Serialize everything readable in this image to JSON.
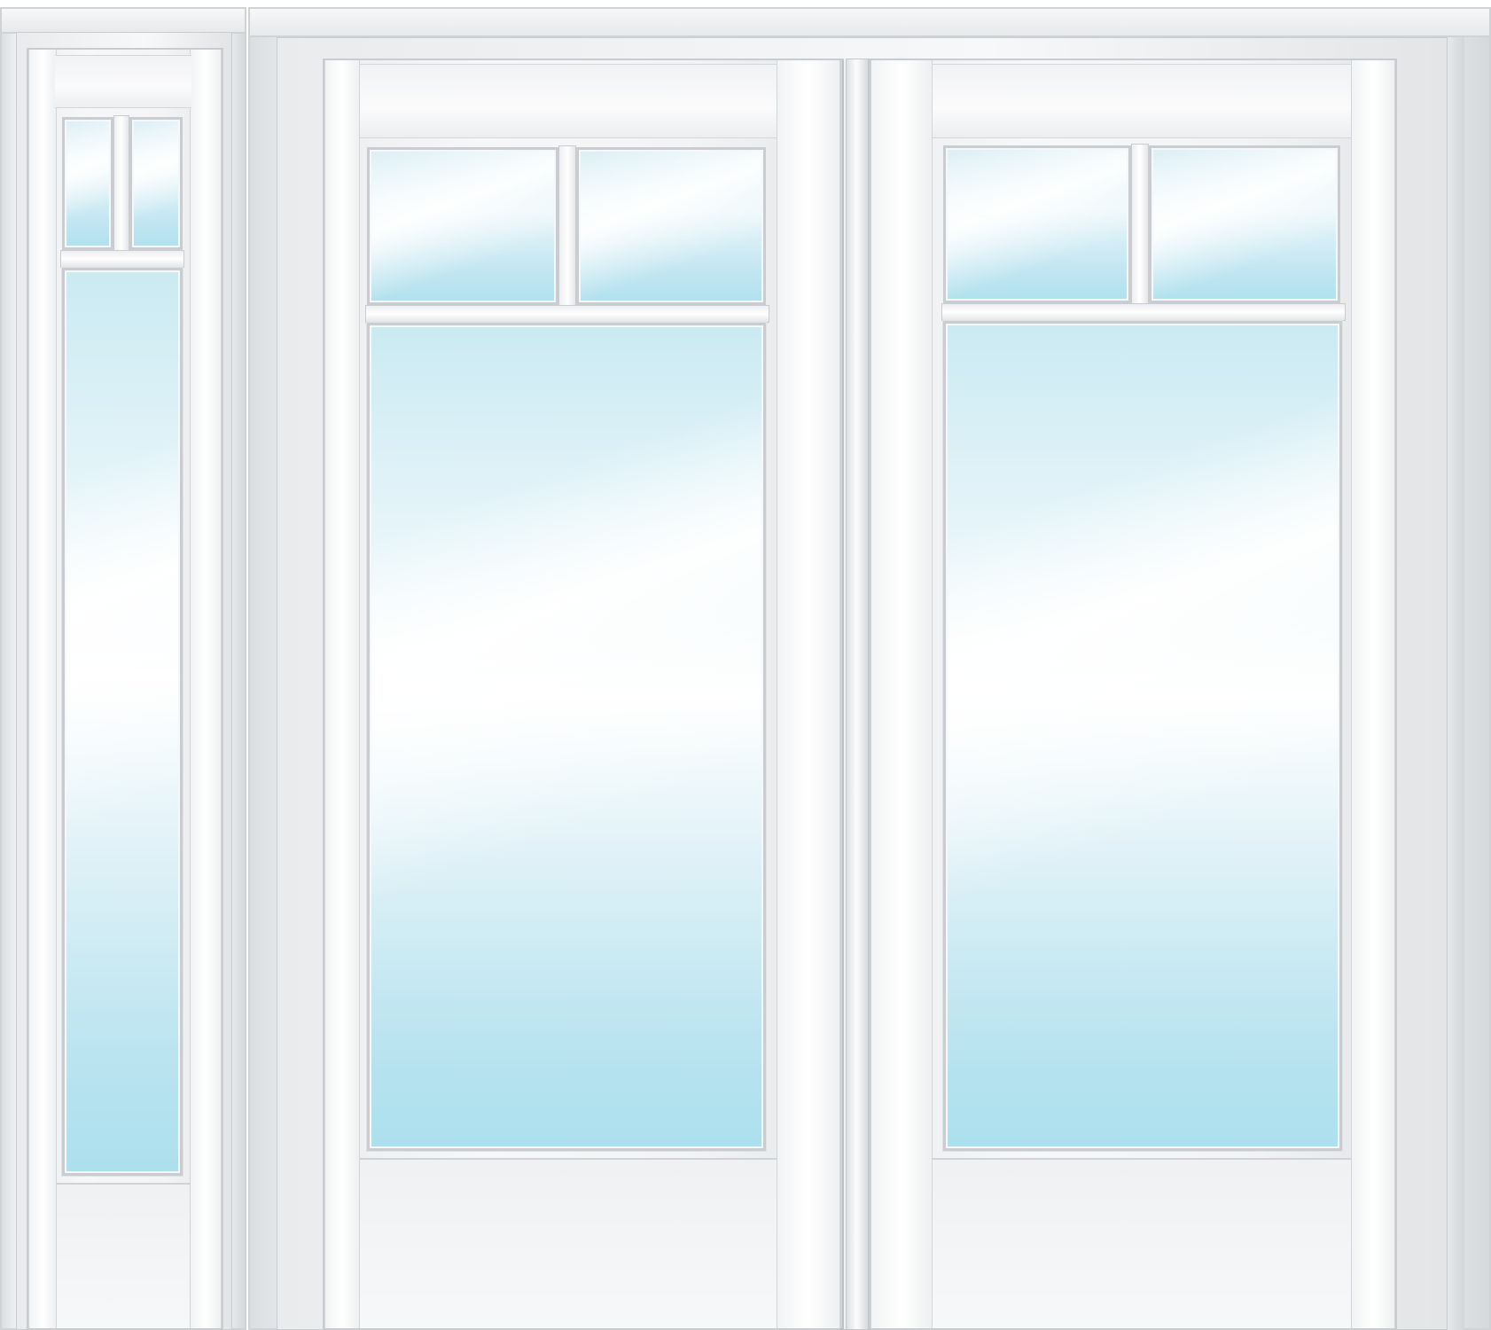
{
  "scene": {
    "subject": "",
    "colors": {
      "frame": "#f3f4f5",
      "frame_edge": "#c8cbcf",
      "glass_top": "#cbeaf2",
      "glass_bottom": "#ace0ee",
      "background": "#ffffff"
    },
    "sidelite": {
      "upper_lites": 2,
      "lower_lites": 1
    },
    "doors": [
      {
        "upper_lites": 2,
        "lower_lites": 1
      },
      {
        "upper_lites": 2,
        "lower_lites": 1
      }
    ]
  }
}
